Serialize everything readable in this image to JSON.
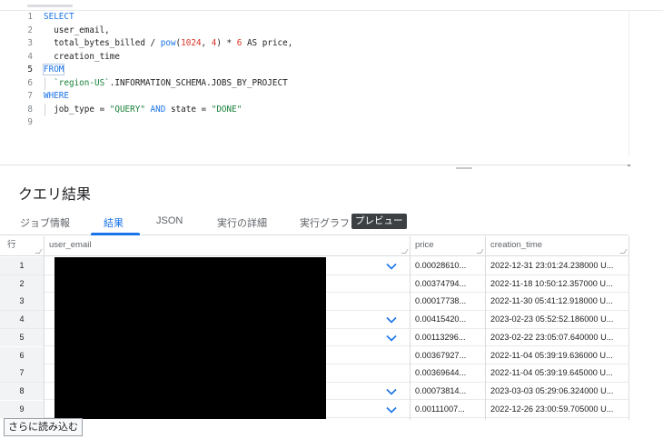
{
  "editor": {
    "lines": [
      {
        "n": "1",
        "tokens": [
          {
            "t": "SELECT",
            "c": "kw"
          }
        ]
      },
      {
        "n": "2",
        "tokens": [
          {
            "t": "  user_email,",
            "c": "txt"
          }
        ]
      },
      {
        "n": "3",
        "tokens": [
          {
            "t": "  total_bytes_billed / ",
            "c": "txt"
          },
          {
            "t": "pow",
            "c": "fn"
          },
          {
            "t": "(",
            "c": "txt"
          },
          {
            "t": "1024",
            "c": "num"
          },
          {
            "t": ", ",
            "c": "txt"
          },
          {
            "t": "4",
            "c": "num"
          },
          {
            "t": ") * ",
            "c": "txt"
          },
          {
            "t": "6",
            "c": "num"
          },
          {
            "t": " AS price,",
            "c": "txt"
          }
        ]
      },
      {
        "n": "4",
        "tokens": [
          {
            "t": "  creation_time",
            "c": "txt"
          }
        ]
      },
      {
        "n": "5",
        "tokens": [
          {
            "t": "FROM",
            "c": "kw"
          }
        ]
      },
      {
        "n": "6",
        "tokens": [
          {
            "t": "  `region-US`",
            "c": "str"
          },
          {
            "t": ".INFORMATION_SCHEMA.JOBS_BY_PROJECT",
            "c": "txt"
          }
        ]
      },
      {
        "n": "7",
        "tokens": [
          {
            "t": "WHERE",
            "c": "kw"
          }
        ]
      },
      {
        "n": "8",
        "tokens": [
          {
            "t": "  job_type = ",
            "c": "txt"
          },
          {
            "t": "\"QUERY\"",
            "c": "str"
          },
          {
            "t": " AND ",
            "c": "kw"
          },
          {
            "t": "state = ",
            "c": "txt"
          },
          {
            "t": "\"DONE\"",
            "c": "str"
          }
        ]
      },
      {
        "n": "9",
        "tokens": []
      }
    ]
  },
  "results": {
    "title": "クエリ結果",
    "tabs": [
      {
        "label": "ジョブ情報"
      },
      {
        "label": "結果"
      },
      {
        "label": "JSON"
      },
      {
        "label": "実行の詳細"
      },
      {
        "label": "実行グラフ"
      }
    ],
    "preview_badge": "プレビュー",
    "columns": {
      "row": "行",
      "user_email": "user_email",
      "price": "price",
      "creation_time": "creation_time"
    },
    "rows": [
      {
        "n": "1",
        "price": "0.00028610...",
        "creation_time": "2022-12-31 23:01:24.238000 U...",
        "expand": true
      },
      {
        "n": "2",
        "price": "0.00374794...",
        "creation_time": "2022-11-18 10:50:12.357000 U...",
        "expand": false
      },
      {
        "n": "3",
        "price": "0.00017738...",
        "creation_time": "2022-11-30 05:41:12.918000 U...",
        "expand": false
      },
      {
        "n": "4",
        "price": "0.00415420...",
        "creation_time": "2023-02-23 05:52:52.186000 U...",
        "expand": true
      },
      {
        "n": "5",
        "price": "0.00113296...",
        "creation_time": "2023-02-22 23:05:07.640000 U...",
        "expand": true
      },
      {
        "n": "6",
        "price": "0.00367927...",
        "creation_time": "2022-11-04 05:39:19.636000 U...",
        "expand": false
      },
      {
        "n": "7",
        "price": "0.00369644...",
        "creation_time": "2022-11-04 05:39:19.645000 U...",
        "expand": false
      },
      {
        "n": "8",
        "price": "0.00073814...",
        "creation_time": "2023-03-03 05:29:06.324000 U...",
        "expand": true
      },
      {
        "n": "9",
        "price": "0.00111007...",
        "creation_time": "2022-12-26 23:00:59.705000 U...",
        "expand": true
      }
    ],
    "load_more": "さらに読み込む"
  },
  "colors": {
    "accent": "#1a73e8",
    "badge_bg": "#3c4043"
  }
}
